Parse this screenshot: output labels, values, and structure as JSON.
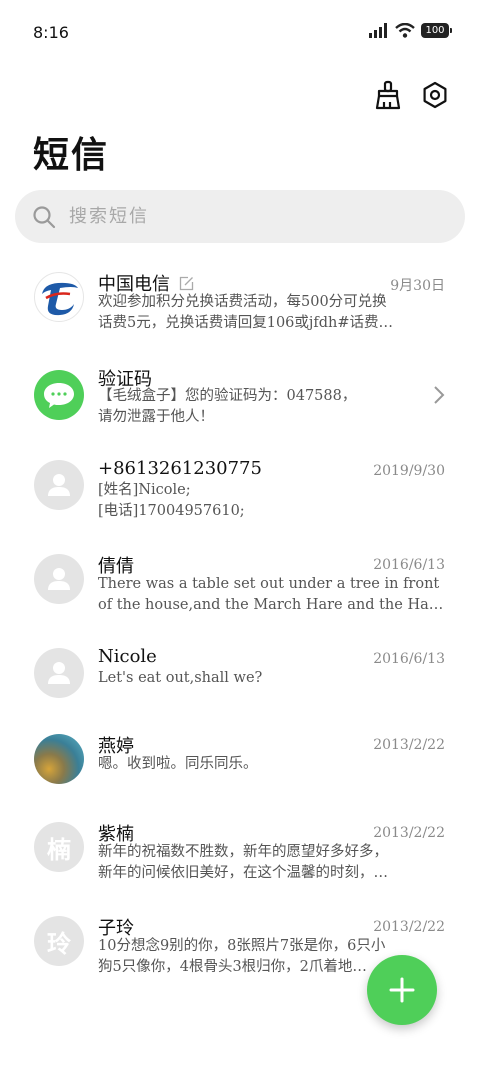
{
  "status_bar": {
    "time": "8:16",
    "battery": "100"
  },
  "header": {
    "title": "短信"
  },
  "search": {
    "placeholder": "搜索短信"
  },
  "colors": {
    "accent": "#4fcf59",
    "avatar_gray": "#e4e4e4",
    "telecom_blue": "#1e5aa8"
  },
  "conversations": [
    {
      "name": "中国电信",
      "date": "9月30日",
      "line1": "欢迎参加积分兑换话费活动，每500分可兑换",
      "line2": "话费5元，兑换话费请回复106或jfdh#话费…",
      "avatar": "china-telecom-logo"
    },
    {
      "name": "验证码",
      "date": "",
      "line1": "【毛绒盒子】您的验证码为：047588，",
      "line2": "请勿泄露于他人！",
      "avatar": "message-bubble-icon"
    },
    {
      "name": "+8613261230775",
      "date": "2019/9/30",
      "line1": "[姓名]Nicole;",
      "line2": "[电话]17004957610;",
      "avatar": "person-icon"
    },
    {
      "name": "倩倩",
      "date": "2016/6/13",
      "line1": "There was a table set out under a tree in front",
      "line2": "of the house,and the March Hare and the Hat…",
      "avatar": "person-icon"
    },
    {
      "name": "Nicole",
      "date": "2016/6/13",
      "line1": "Let's eat out,shall we?",
      "line2": "",
      "avatar": "person-icon"
    },
    {
      "name": "燕婷",
      "date": "2013/2/22",
      "line1": "嗯。收到啦。同乐同乐。",
      "line2": "",
      "avatar": "photo"
    },
    {
      "name": "紫楠",
      "date": "2013/2/22",
      "line1": "新年的祝福数不胜数，新年的愿望好多好多，",
      "line2": "新年的问候依旧美好，在这个温馨的时刻，…",
      "avatar_letter": "楠"
    },
    {
      "name": "子玲",
      "date": "2013/2/22",
      "line1": "10分想念9别的你，8张照片7张是你，6只小",
      "line2": "狗5只像你，4根骨头3根归你，2爪着地…",
      "avatar_letter": "玲"
    }
  ]
}
